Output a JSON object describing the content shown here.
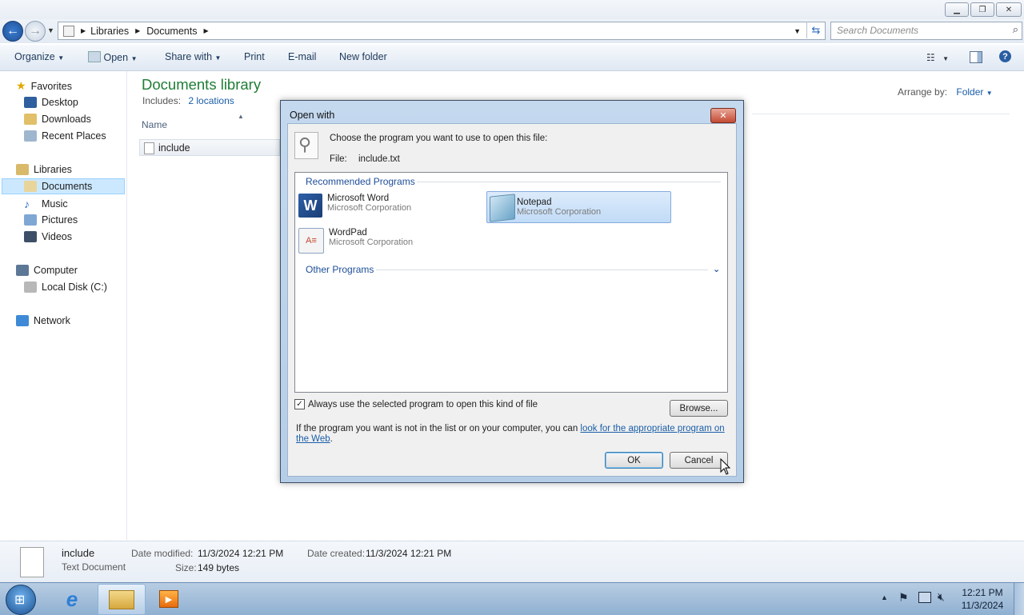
{
  "window": {
    "caption_buttons": [
      "minimize",
      "maximize",
      "close"
    ]
  },
  "address": {
    "breadcrumb": [
      "Libraries",
      "Documents"
    ],
    "search_placeholder": "Search Documents"
  },
  "toolbar": {
    "organize": "Organize",
    "open": "Open",
    "share_with": "Share with",
    "print": "Print",
    "email": "E-mail",
    "new_folder": "New folder"
  },
  "sidebar": {
    "favorites": {
      "label": "Favorites",
      "items": [
        "Desktop",
        "Downloads",
        "Recent Places"
      ]
    },
    "libraries": {
      "label": "Libraries",
      "items": [
        "Documents",
        "Music",
        "Pictures",
        "Videos"
      ]
    },
    "computer": {
      "label": "Computer",
      "items": [
        "Local Disk (C:)"
      ]
    },
    "network": {
      "label": "Network"
    }
  },
  "content": {
    "title": "Documents library",
    "includes_label": "Includes:",
    "includes_link": "2 locations",
    "arrange_label": "Arrange by:",
    "arrange_value": "Folder",
    "column_name": "Name",
    "files": [
      "include"
    ]
  },
  "dialog": {
    "title": "Open with",
    "instruction": "Choose the program you want to use to open this file:",
    "file_label": "File:",
    "file_name": "include.txt",
    "recommended_header": "Recommended Programs",
    "other_header": "Other Programs",
    "programs": [
      {
        "name": "Microsoft Word",
        "corp": "Microsoft Corporation",
        "selected": false
      },
      {
        "name": "Notepad",
        "corp": "Microsoft Corporation",
        "selected": true
      },
      {
        "name": "WordPad",
        "corp": "Microsoft Corporation",
        "selected": false
      }
    ],
    "always_use_label": "Always use the selected program to open this kind of file",
    "always_use_checked": true,
    "browse_button": "Browse...",
    "hint_prefix": "If the program you want is not in the list or on your computer, you can",
    "hint_link": "look for the appropriate program on the Web",
    "hint_suffix": ".",
    "ok_button": "OK",
    "cancel_button": "Cancel"
  },
  "details": {
    "file_name": "include",
    "file_type": "Text Document",
    "date_modified_label": "Date modified:",
    "date_modified_value": "11/3/2024 12:21 PM",
    "date_created_label": "Date created:",
    "date_created_value": "11/3/2024 12:21 PM",
    "size_label": "Size:",
    "size_value": "149 bytes"
  },
  "taskbar": {
    "time": "12:21 PM",
    "date": "11/3/2024"
  },
  "colors": {
    "library_title": "#1e7d34",
    "link": "#1a5ea8",
    "selection": "#cce8ff"
  }
}
